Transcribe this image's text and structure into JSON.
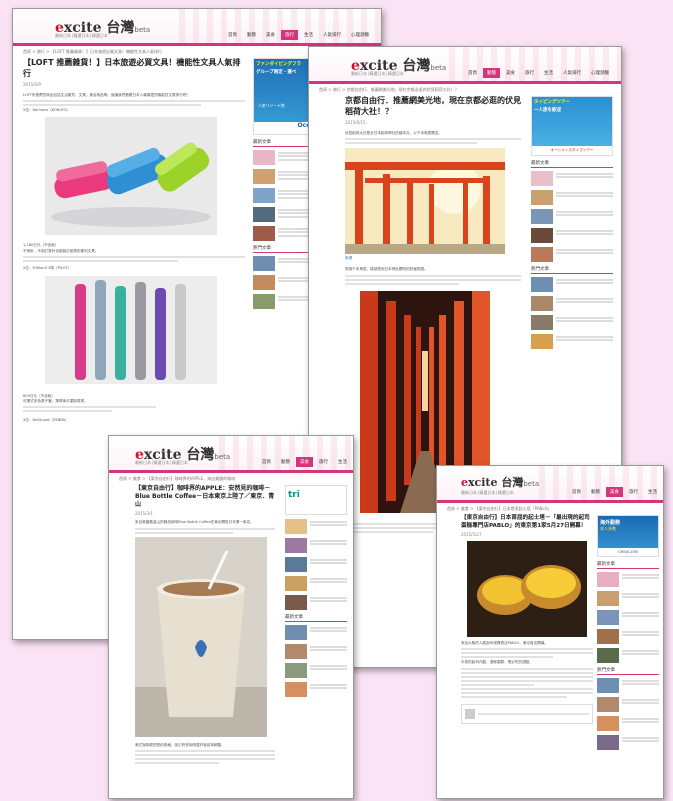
{
  "brand": {
    "logo_main": "xcite",
    "logo_cjk": "台灣",
    "logo_suffix": "beta",
    "accent": "#d4367c",
    "logo_e": "#c8102e"
  },
  "nav_items": [
    "首頁",
    "動態",
    "美食",
    "旅行",
    "生活",
    "人氣排行",
    "心理測驗"
  ],
  "win1": {
    "tagline": "最新日本│精選日本│精選日本",
    "breadcrumb": "首頁 > 旅行 > 【LOFT 推薦雜貨！】日本旅遊必買文具！機能性文具人氣排行",
    "title": "【LOFT 推薦雜貨！】日本旅遊必買文具！機能性文具人氣排行",
    "date": "2015/6/9",
    "intro": "LOFT所推薦的商品包括生活雜貨、文具、美容用品等。就讓我們看看日本人最喜愛的機能性文具排行吧！",
    "credit1": "2位：Harinacs（KOKUYO）",
    "price1": "1,180日元（不含稅）",
    "desc1": "不用針，不用訂書針也能裝訂紙張的便利文具。",
    "credit2": "2位：FriXion3 3球（PILOT）",
    "price2": "600日元（不含稅）",
    "desc2": "可擦式多色原子筆，擦掉後可重新書寫。",
    "credit3": "3位：DelGuard（ZEBRA）",
    "ad_lines": [
      "ファンダイビングフラ",
      "グループ限定・選べ"
    ],
    "ad_bottom": "Oceanus",
    "ad_small": "人気リゾート地",
    "related_heading": "最新文章",
    "popular_heading": "熱門文章"
  },
  "win2": {
    "tagline": "最新日本│精選日本│精選日本",
    "breadcrumb": "首頁 > 旅行 > 京都自由行．推薦網美光地，現在京都必逛的伏見稻荷大社！？",
    "title": "京都自由行．推薦網美光地，現在京都必逛的伏見稻荷大社！？",
    "date": "2015/6/15",
    "intro": "伏見稻荷大社是全日本稻荷神社的總本社，以千本鳥居聞名。",
    "photo_credit": "來源",
    "body": "穿過千本鳥居，能感受到日本神社獨特的莊嚴氛圍。",
    "ad_lines": [
      "タイビングツアー",
      "一人旅を歓迎"
    ],
    "ad_brand": "オーシャンズダイブツアー",
    "side_heading": "最新文章",
    "side_heading2": "熱門文章"
  },
  "win3": {
    "tagline": "最新日本│精選日本│精選日本",
    "breadcrumb": "首頁 > 美食 > 【東京自由行】咖啡界的APPLE，來自美國的咖啡",
    "title": "【東京自由行】咖啡界的APPLE：安然見的咖啡－Blue Bottle Coffee－日本東京上陸了／東京．青山",
    "date": "2015/3/1",
    "intro": "來自美國舊金山的精品咖啡Blue Bottle Coffee在東京開設日本第一家店。",
    "body": "美式咖啡廳的簡約風格，吸引許多咖啡愛好者前來朝聖。",
    "ad_text": "tri",
    "side_heading": "最新文章"
  },
  "win4": {
    "tagline": "最新日本│精選日本│精選日本",
    "breadcrumb": "首頁 > 美食 > 【東京自由行】日本首家起士塔「PABLO」",
    "title": "【東京自由行】日本首屈的起士塔－「最出現的起司蛋糕專門店PABLO」的東京第1家5月27日開幕！",
    "date": "2015/5/27",
    "intro": "來自大阪的人氣起司塔專賣店PABLO，東京首店開幕。",
    "body": "半熟的起司內餡，濃郁香醇，是必吃的甜點。",
    "ad_lines": [
      "海外勤務",
      "求人多数"
    ],
    "ad_brand": "CREACIÓN",
    "side_heading": "最新文章",
    "side_heading2": "熱門文章"
  }
}
